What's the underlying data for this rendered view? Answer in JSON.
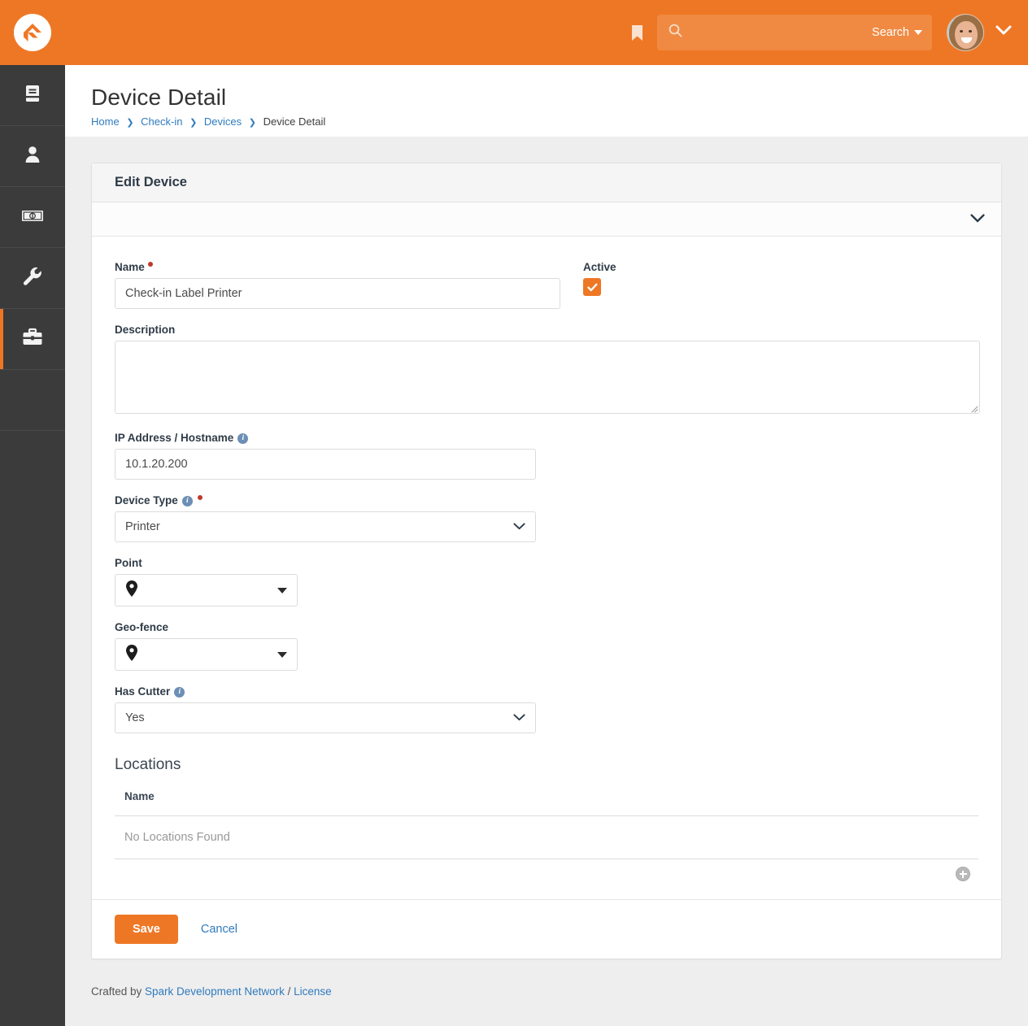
{
  "brand": {
    "accent_color": "#ee7725",
    "link_color": "#2f7bbd",
    "sidebar_color": "#3b3b3b",
    "logo_name": "rock-rms-logo"
  },
  "topbar": {
    "bookmark_icon": "bookmark-icon",
    "search": {
      "icon": "search-icon",
      "value": "",
      "placeholder": "",
      "dropdown_label": "Search"
    },
    "user": {
      "avatar_alt": "user-avatar",
      "chevron_icon": "chevron-down-icon"
    }
  },
  "sidebar": {
    "items": [
      {
        "icon": "book-icon",
        "name": "cms",
        "active": false
      },
      {
        "icon": "person-icon",
        "name": "people",
        "active": false
      },
      {
        "icon": "money-icon",
        "name": "finance",
        "active": false
      },
      {
        "icon": "wrench-icon",
        "name": "admin-tools",
        "active": false
      },
      {
        "icon": "briefcase-icon",
        "name": "tools",
        "active": true
      }
    ]
  },
  "page": {
    "title": "Device Detail",
    "breadcrumb": [
      {
        "label": "Home",
        "link": true
      },
      {
        "label": "Check-in",
        "link": true
      },
      {
        "label": "Devices",
        "link": true
      },
      {
        "label": "Device Detail",
        "link": false
      }
    ]
  },
  "panel": {
    "title": "Edit Device",
    "collapse_icon": "chevron-down-icon"
  },
  "form": {
    "name": {
      "label": "Name",
      "required": true,
      "value": "Check-in Label Printer",
      "placeholder": ""
    },
    "active": {
      "label": "Active",
      "checked": true
    },
    "description": {
      "label": "Description",
      "value": "",
      "placeholder": ""
    },
    "ip_address": {
      "label": "IP Address / Hostname",
      "has_info": true,
      "value": "10.1.20.200",
      "placeholder": ""
    },
    "device_type": {
      "label": "Device Type",
      "has_info": true,
      "required": true,
      "value": "Printer",
      "options": [
        "Printer"
      ]
    },
    "point": {
      "label": "Point",
      "icon": "map-pin-icon",
      "value": ""
    },
    "geofence": {
      "label": "Geo-fence",
      "icon": "map-pin-icon",
      "value": ""
    },
    "has_cutter": {
      "label": "Has Cutter",
      "has_info": true,
      "value": "Yes",
      "options": [
        "Yes"
      ]
    }
  },
  "locations": {
    "title": "Locations",
    "columns": [
      "Name"
    ],
    "rows": [],
    "empty_text": "No Locations Found",
    "add_button": "add-location-button"
  },
  "actions": {
    "save_label": "Save",
    "cancel_label": "Cancel"
  },
  "footer": {
    "prefix": "Crafted by ",
    "org": "Spark Development Network",
    "separator": " / ",
    "license": "License"
  }
}
